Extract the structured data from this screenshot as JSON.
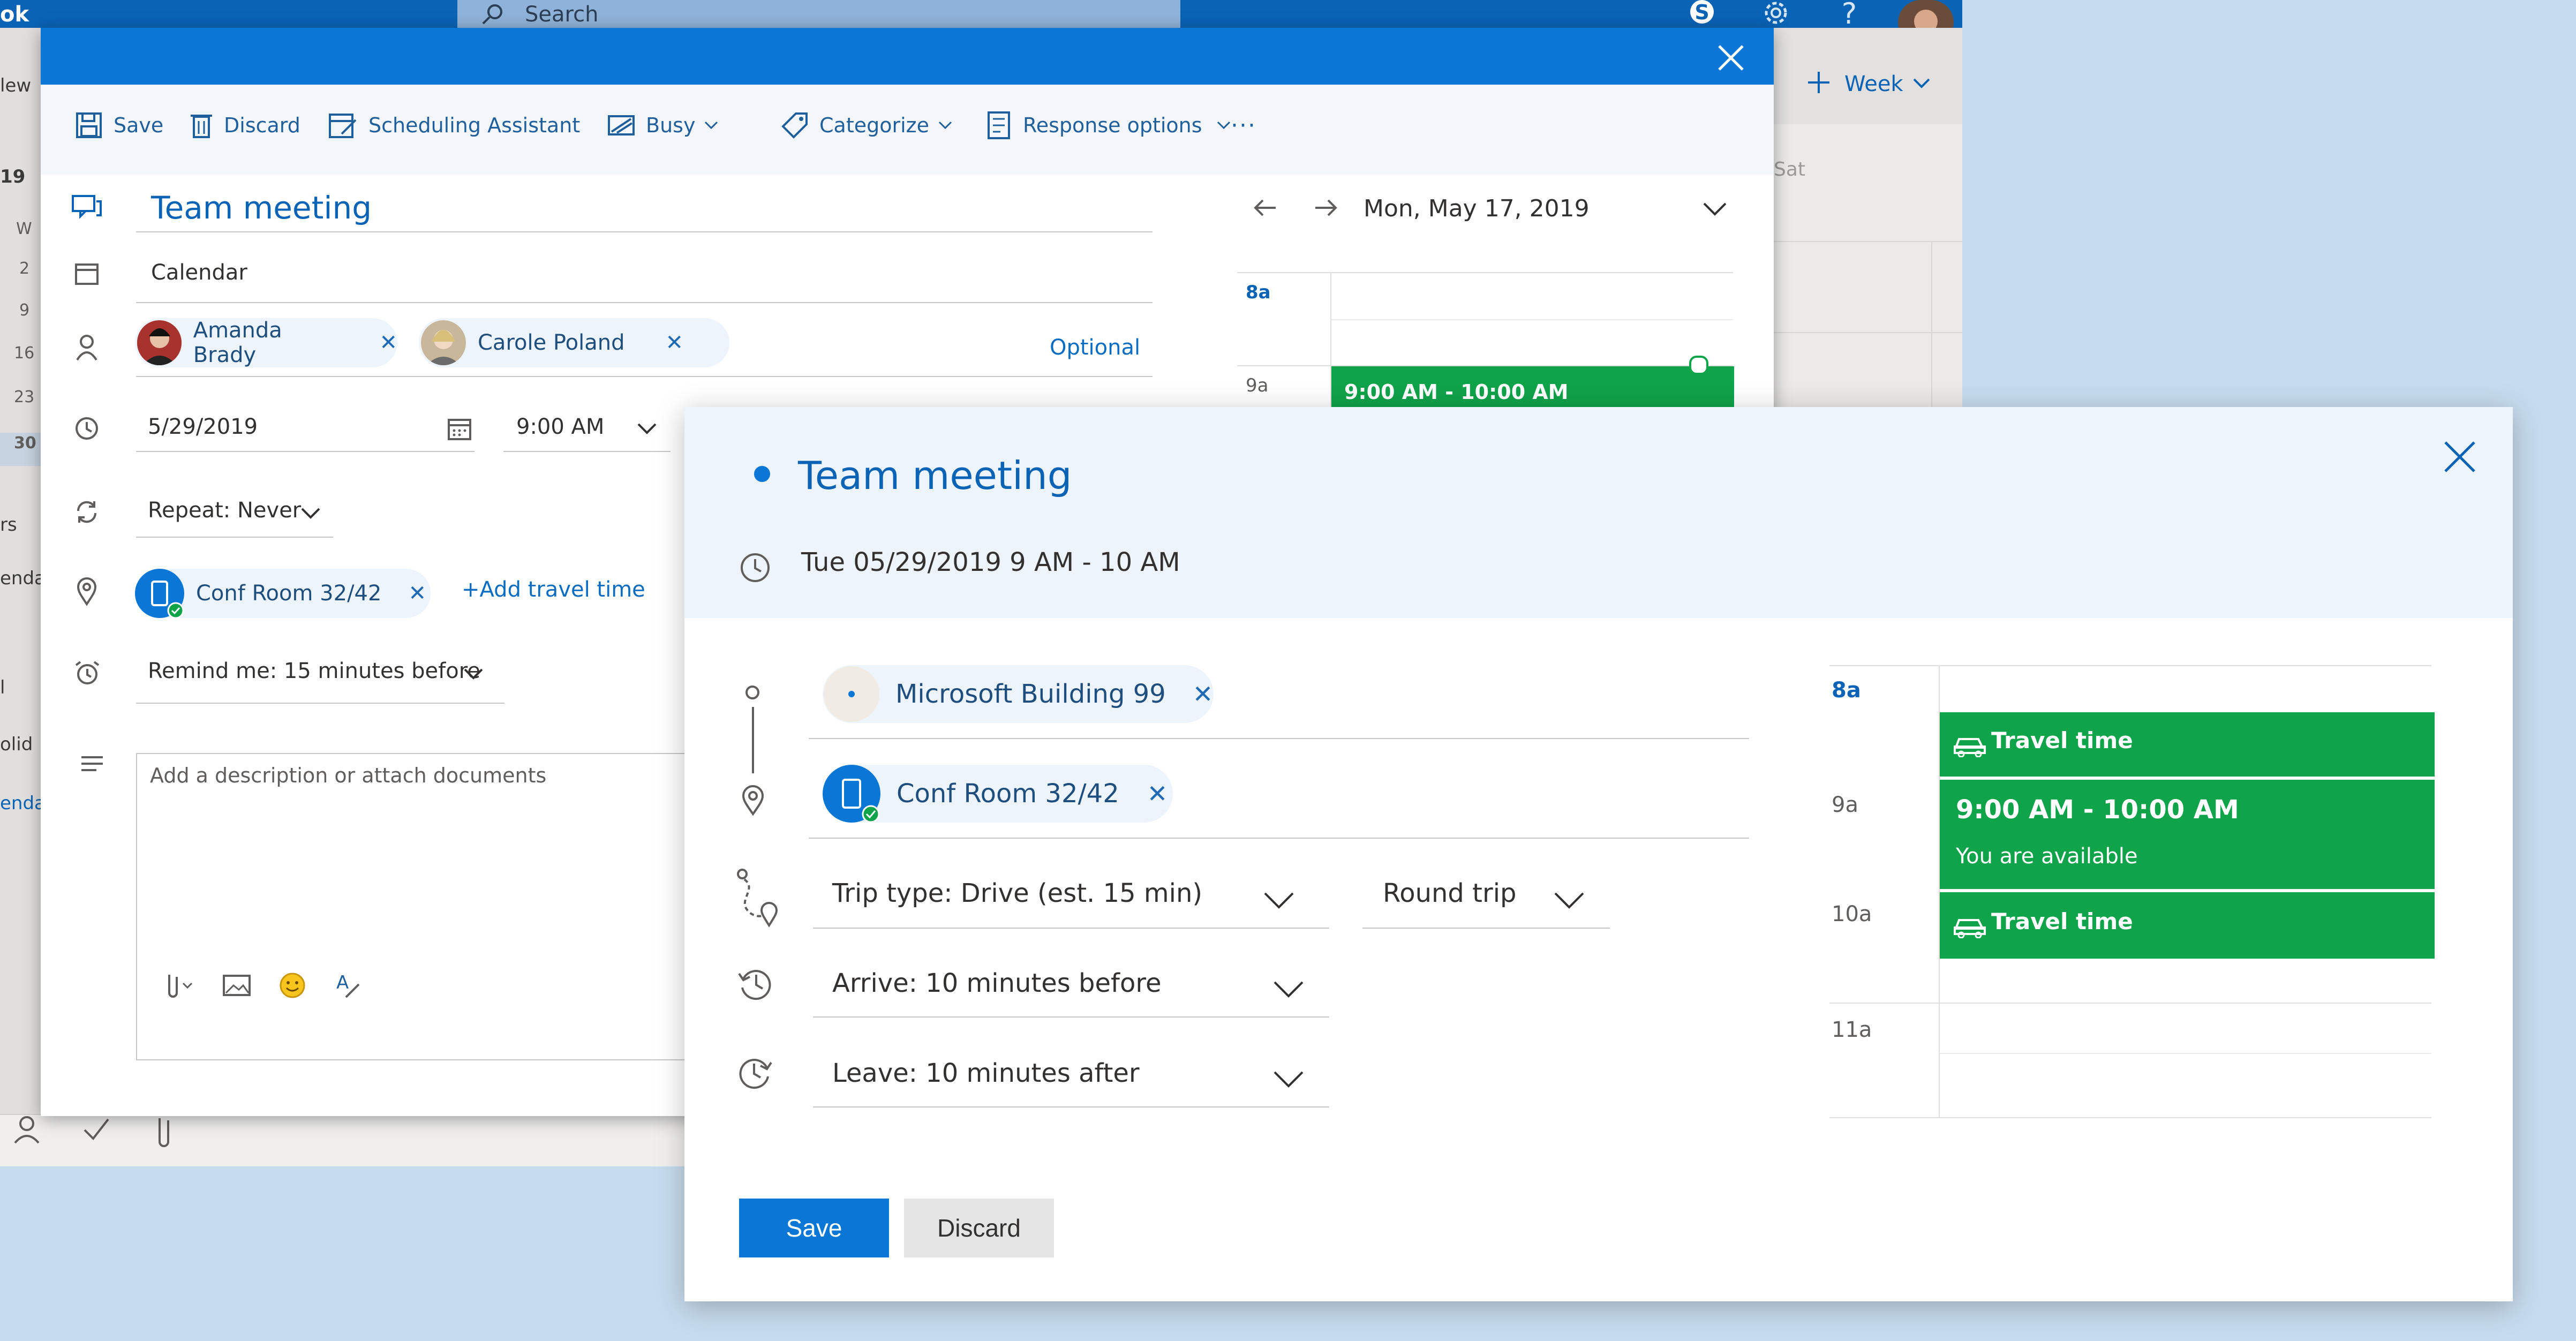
{
  "background_app": {
    "brand_fragment": "ok",
    "search_placeholder": "Search",
    "sidebar_fragments": [
      "lew",
      "19",
      "W",
      "2",
      "9",
      "16",
      "23",
      "30",
      "rs",
      "enda",
      "l",
      "olid",
      "enda"
    ],
    "week_button": "Week",
    "day_label": "Sat"
  },
  "event_form": {
    "toolbar": {
      "save": "Save",
      "discard": "Discard",
      "scheduling_assistant": "Scheduling Assistant",
      "busy": "Busy",
      "categorize": "Categorize",
      "response_options": "Response options",
      "more": "···"
    },
    "title": "Team meeting",
    "calendar": "Calendar",
    "attendees": [
      {
        "name": "Amanda Brady"
      },
      {
        "name": "Carole Poland"
      }
    ],
    "optional_link": "Optional",
    "date": "5/29/2019",
    "time": "9:00 AM",
    "repeat": "Repeat: Never",
    "location": "Conf Room 32/42",
    "add_travel_time": "+Add travel time",
    "reminder": "Remind me: 15 minutes before",
    "description_placeholder": "Add a description or attach documents",
    "mini_calendar": {
      "date_label": "Mon, May 17, 2019",
      "hours": [
        "8a",
        "9a"
      ],
      "event_label": "9:00 AM - 10:00 AM"
    }
  },
  "travel_dialog": {
    "title": "Team meeting",
    "datetime": "Tue 05/29/2019 9 AM - 10 AM",
    "origin": "Microsoft Building 99",
    "destination": "Conf Room 32/42",
    "trip_type": "Trip type: Drive (est. 15 min)",
    "round_trip": "Round trip",
    "arrive": "Arrive: 10 minutes before",
    "leave": "Leave: 10 minutes after",
    "save": "Save",
    "discard": "Discard",
    "schedule": {
      "hours": [
        "8a",
        "9a",
        "10a",
        "11a"
      ],
      "travel_label": "Travel time",
      "event_time": "9:00 AM - 10:00 AM",
      "availability": "You are available"
    }
  },
  "colors": {
    "brand_blue": "#0a77d6",
    "link_blue": "#0a63b5",
    "event_green": "#0fa34a",
    "page_bg": "#c6dcee"
  }
}
